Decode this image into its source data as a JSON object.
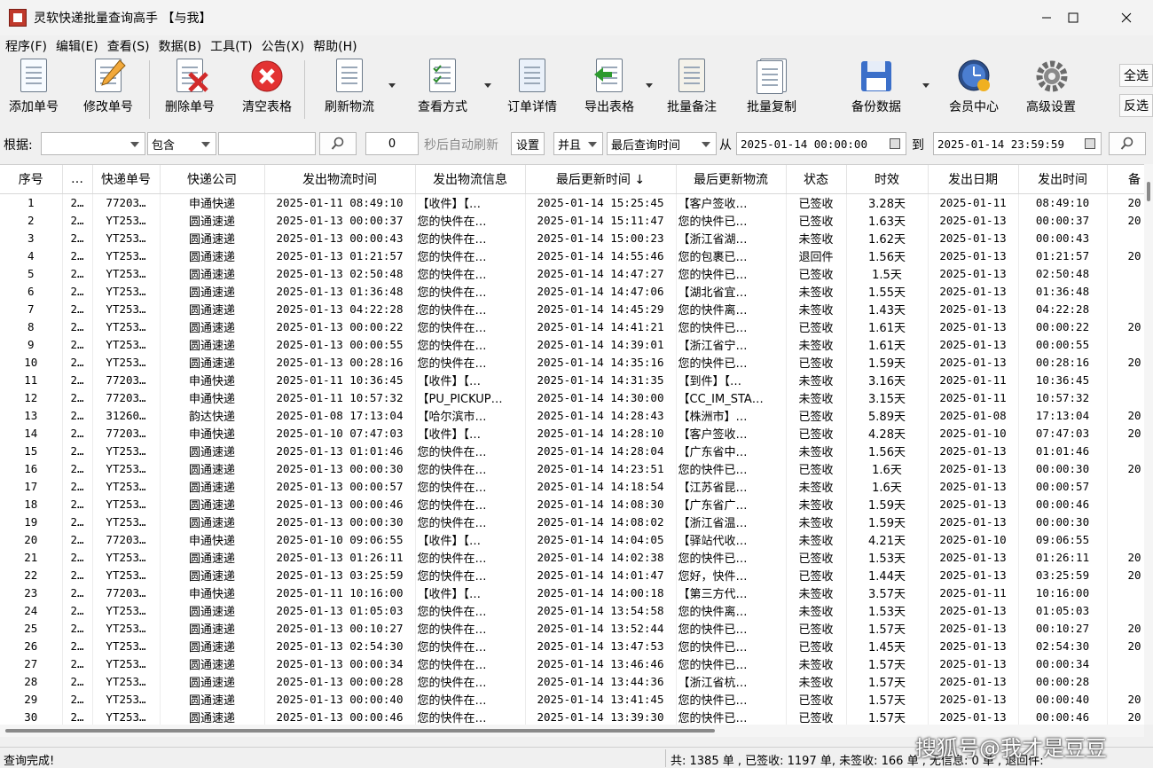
{
  "window": {
    "title": "灵软快递批量查询高手  【与我】"
  },
  "menu": [
    "程序(F)",
    "编辑(E)",
    "查看(S)",
    "数据(B)",
    "工具(T)",
    "公告(X)",
    "帮助(H)"
  ],
  "toolbar": {
    "add": "添加单号",
    "edit": "修改单号",
    "delete": "删除单号",
    "clear": "清空表格",
    "refresh": "刷新物流",
    "view": "查看方式",
    "order": "订单详情",
    "export": "导出表格",
    "remark": "批量备注",
    "copy": "批量复制",
    "backup": "备份数据",
    "member": "会员中心",
    "advanced": "高级设置",
    "select_all": "全选",
    "invert": "反选"
  },
  "filter": {
    "basis_label": "根据:",
    "basis_value": "",
    "match_value": "包含",
    "keyword_value": "",
    "seconds_value": "0",
    "auto_refresh_label": "秒后自动刷新",
    "settings_label": "设置",
    "logic_value": "并且",
    "time_field_value": "最后查询时间",
    "from_label": "从",
    "from_value": "2025-01-14 00:00:00",
    "to_label": "到",
    "to_value": "2025-01-14 23:59:59"
  },
  "table": {
    "columns": [
      "序号",
      "…",
      "快递单号",
      "快递公司",
      "发出物流时间",
      "发出物流信息",
      "最后更新时间 ↓",
      "最后更新物流",
      "状态",
      "时效",
      "发出日期",
      "发出时间",
      "备"
    ],
    "rows": [
      [
        "1",
        "2…",
        "77203…",
        "申通快递",
        "2025-01-11 08:49:10",
        "【收件】【…",
        "2025-01-14 15:25:45",
        "【客户签收…",
        "已签收",
        "3.28天",
        "2025-01-11",
        "08:49:10",
        "20"
      ],
      [
        "2",
        "2…",
        "YT253…",
        "圆通速递",
        "2025-01-13 00:00:37",
        "您的快件在…",
        "2025-01-14 15:11:47",
        "您的快件已…",
        "已签收",
        "1.63天",
        "2025-01-13",
        "00:00:37",
        "20"
      ],
      [
        "3",
        "2…",
        "YT253…",
        "圆通速递",
        "2025-01-13 00:00:43",
        "您的快件在…",
        "2025-01-14 15:00:23",
        "【浙江省湖…",
        "未签收",
        "1.62天",
        "2025-01-13",
        "00:00:43",
        ""
      ],
      [
        "4",
        "2…",
        "YT253…",
        "圆通速递",
        "2025-01-13 01:21:57",
        "您的快件在…",
        "2025-01-14 14:55:46",
        "您的包裹已…",
        "退回件",
        "1.56天",
        "2025-01-13",
        "01:21:57",
        "20"
      ],
      [
        "5",
        "2…",
        "YT253…",
        "圆通速递",
        "2025-01-13 02:50:48",
        "您的快件在…",
        "2025-01-14 14:47:27",
        "您的快件已…",
        "已签收",
        "1.5天",
        "2025-01-13",
        "02:50:48",
        ""
      ],
      [
        "6",
        "2…",
        "YT253…",
        "圆通速递",
        "2025-01-13 01:36:48",
        "您的快件在…",
        "2025-01-14 14:47:06",
        "【湖北省宜…",
        "未签收",
        "1.55天",
        "2025-01-13",
        "01:36:48",
        ""
      ],
      [
        "7",
        "2…",
        "YT253…",
        "圆通速递",
        "2025-01-13 04:22:28",
        "您的快件在…",
        "2025-01-14 14:45:29",
        "您的快件离…",
        "未签收",
        "1.43天",
        "2025-01-13",
        "04:22:28",
        ""
      ],
      [
        "8",
        "2…",
        "YT253…",
        "圆通速递",
        "2025-01-13 00:00:22",
        "您的快件在…",
        "2025-01-14 14:41:21",
        "您的快件已…",
        "已签收",
        "1.61天",
        "2025-01-13",
        "00:00:22",
        "20"
      ],
      [
        "9",
        "2…",
        "YT253…",
        "圆通速递",
        "2025-01-13 00:00:55",
        "您的快件在…",
        "2025-01-14 14:39:01",
        "【浙江省宁…",
        "未签收",
        "1.61天",
        "2025-01-13",
        "00:00:55",
        ""
      ],
      [
        "10",
        "2…",
        "YT253…",
        "圆通速递",
        "2025-01-13 00:28:16",
        "您的快件在…",
        "2025-01-14 14:35:16",
        "您的快件已…",
        "已签收",
        "1.59天",
        "2025-01-13",
        "00:28:16",
        "20"
      ],
      [
        "11",
        "2…",
        "77203…",
        "申通快递",
        "2025-01-11 10:36:45",
        "【收件】【…",
        "2025-01-14 14:31:35",
        "【到件】【…",
        "未签收",
        "3.16天",
        "2025-01-11",
        "10:36:45",
        ""
      ],
      [
        "12",
        "2…",
        "77203…",
        "申通快递",
        "2025-01-11 10:57:32",
        "【PU_PICKUP…",
        "2025-01-14 14:30:00",
        "【CC_IM_STA…",
        "未签收",
        "3.15天",
        "2025-01-11",
        "10:57:32",
        ""
      ],
      [
        "13",
        "2…",
        "31260…",
        "韵达快递",
        "2025-01-08 17:13:04",
        "【哈尔滨市…",
        "2025-01-14 14:28:43",
        "【株洲市】…",
        "已签收",
        "5.89天",
        "2025-01-08",
        "17:13:04",
        "20"
      ],
      [
        "14",
        "2…",
        "77203…",
        "申通快递",
        "2025-01-10 07:47:03",
        "【收件】【…",
        "2025-01-14 14:28:10",
        "【客户签收…",
        "已签收",
        "4.28天",
        "2025-01-10",
        "07:47:03",
        "20"
      ],
      [
        "15",
        "2…",
        "YT253…",
        "圆通速递",
        "2025-01-13 01:01:46",
        "您的快件在…",
        "2025-01-14 14:28:04",
        "【广东省中…",
        "未签收",
        "1.56天",
        "2025-01-13",
        "01:01:46",
        ""
      ],
      [
        "16",
        "2…",
        "YT253…",
        "圆通速递",
        "2025-01-13 00:00:30",
        "您的快件在…",
        "2025-01-14 14:23:51",
        "您的快件已…",
        "已签收",
        "1.6天",
        "2025-01-13",
        "00:00:30",
        "20"
      ],
      [
        "17",
        "2…",
        "YT253…",
        "圆通速递",
        "2025-01-13 00:00:57",
        "您的快件在…",
        "2025-01-14 14:18:54",
        "【江苏省昆…",
        "未签收",
        "1.6天",
        "2025-01-13",
        "00:00:57",
        ""
      ],
      [
        "18",
        "2…",
        "YT253…",
        "圆通速递",
        "2025-01-13 00:00:46",
        "您的快件在…",
        "2025-01-14 14:08:30",
        "【广东省广…",
        "未签收",
        "1.59天",
        "2025-01-13",
        "00:00:46",
        ""
      ],
      [
        "19",
        "2…",
        "YT253…",
        "圆通速递",
        "2025-01-13 00:00:30",
        "您的快件在…",
        "2025-01-14 14:08:02",
        "【浙江省温…",
        "未签收",
        "1.59天",
        "2025-01-13",
        "00:00:30",
        ""
      ],
      [
        "20",
        "2…",
        "77203…",
        "申通快递",
        "2025-01-10 09:06:55",
        "【收件】【…",
        "2025-01-14 14:04:05",
        "【驿站代收…",
        "未签收",
        "4.21天",
        "2025-01-10",
        "09:06:55",
        ""
      ],
      [
        "21",
        "2…",
        "YT253…",
        "圆通速递",
        "2025-01-13 01:26:11",
        "您的快件在…",
        "2025-01-14 14:02:38",
        "您的快件已…",
        "已签收",
        "1.53天",
        "2025-01-13",
        "01:26:11",
        "20"
      ],
      [
        "22",
        "2…",
        "YT253…",
        "圆通速递",
        "2025-01-13 03:25:59",
        "您的快件在…",
        "2025-01-14 14:01:47",
        "您好，快件…",
        "已签收",
        "1.44天",
        "2025-01-13",
        "03:25:59",
        "20"
      ],
      [
        "23",
        "2…",
        "77203…",
        "申通快递",
        "2025-01-11 10:16:00",
        "【收件】【…",
        "2025-01-14 14:00:18",
        "【第三方代…",
        "未签收",
        "3.57天",
        "2025-01-11",
        "10:16:00",
        ""
      ],
      [
        "24",
        "2…",
        "YT253…",
        "圆通速递",
        "2025-01-13 01:05:03",
        "您的快件在…",
        "2025-01-14 13:54:58",
        "您的快件离…",
        "未签收",
        "1.53天",
        "2025-01-13",
        "01:05:03",
        ""
      ],
      [
        "25",
        "2…",
        "YT253…",
        "圆通速递",
        "2025-01-13 00:10:27",
        "您的快件在…",
        "2025-01-14 13:52:44",
        "您的快件已…",
        "已签收",
        "1.57天",
        "2025-01-13",
        "00:10:27",
        "20"
      ],
      [
        "26",
        "2…",
        "YT253…",
        "圆通速递",
        "2025-01-13 02:54:30",
        "您的快件在…",
        "2025-01-14 13:47:53",
        "您的快件已…",
        "已签收",
        "1.45天",
        "2025-01-13",
        "02:54:30",
        "20"
      ],
      [
        "27",
        "2…",
        "YT253…",
        "圆通速递",
        "2025-01-13 00:00:34",
        "您的快件在…",
        "2025-01-14 13:46:46",
        "您的快件已…",
        "未签收",
        "1.57天",
        "2025-01-13",
        "00:00:34",
        ""
      ],
      [
        "28",
        "2…",
        "YT253…",
        "圆通速递",
        "2025-01-13 00:00:28",
        "您的快件在…",
        "2025-01-14 13:44:36",
        "【浙江省杭…",
        "未签收",
        "1.57天",
        "2025-01-13",
        "00:00:28",
        ""
      ],
      [
        "29",
        "2…",
        "YT253…",
        "圆通速递",
        "2025-01-13 00:00:40",
        "您的快件在…",
        "2025-01-14 13:41:45",
        "您的快件已…",
        "已签收",
        "1.57天",
        "2025-01-13",
        "00:00:40",
        "20"
      ],
      [
        "30",
        "2…",
        "YT253…",
        "圆通速递",
        "2025-01-13 00:00:46",
        "您的快件在…",
        "2025-01-14 13:39:30",
        "您的快件已…",
        "已签收",
        "1.57天",
        "2025-01-13",
        "00:00:46",
        "20"
      ]
    ]
  },
  "status": {
    "left": "查询完成!",
    "right": "共: 1385 单 , 已签收:  1197 单, 未签收:  166 单 , 无信息: 0 单 , 退回件:"
  },
  "watermark": "搜狐号@我才是豆豆"
}
